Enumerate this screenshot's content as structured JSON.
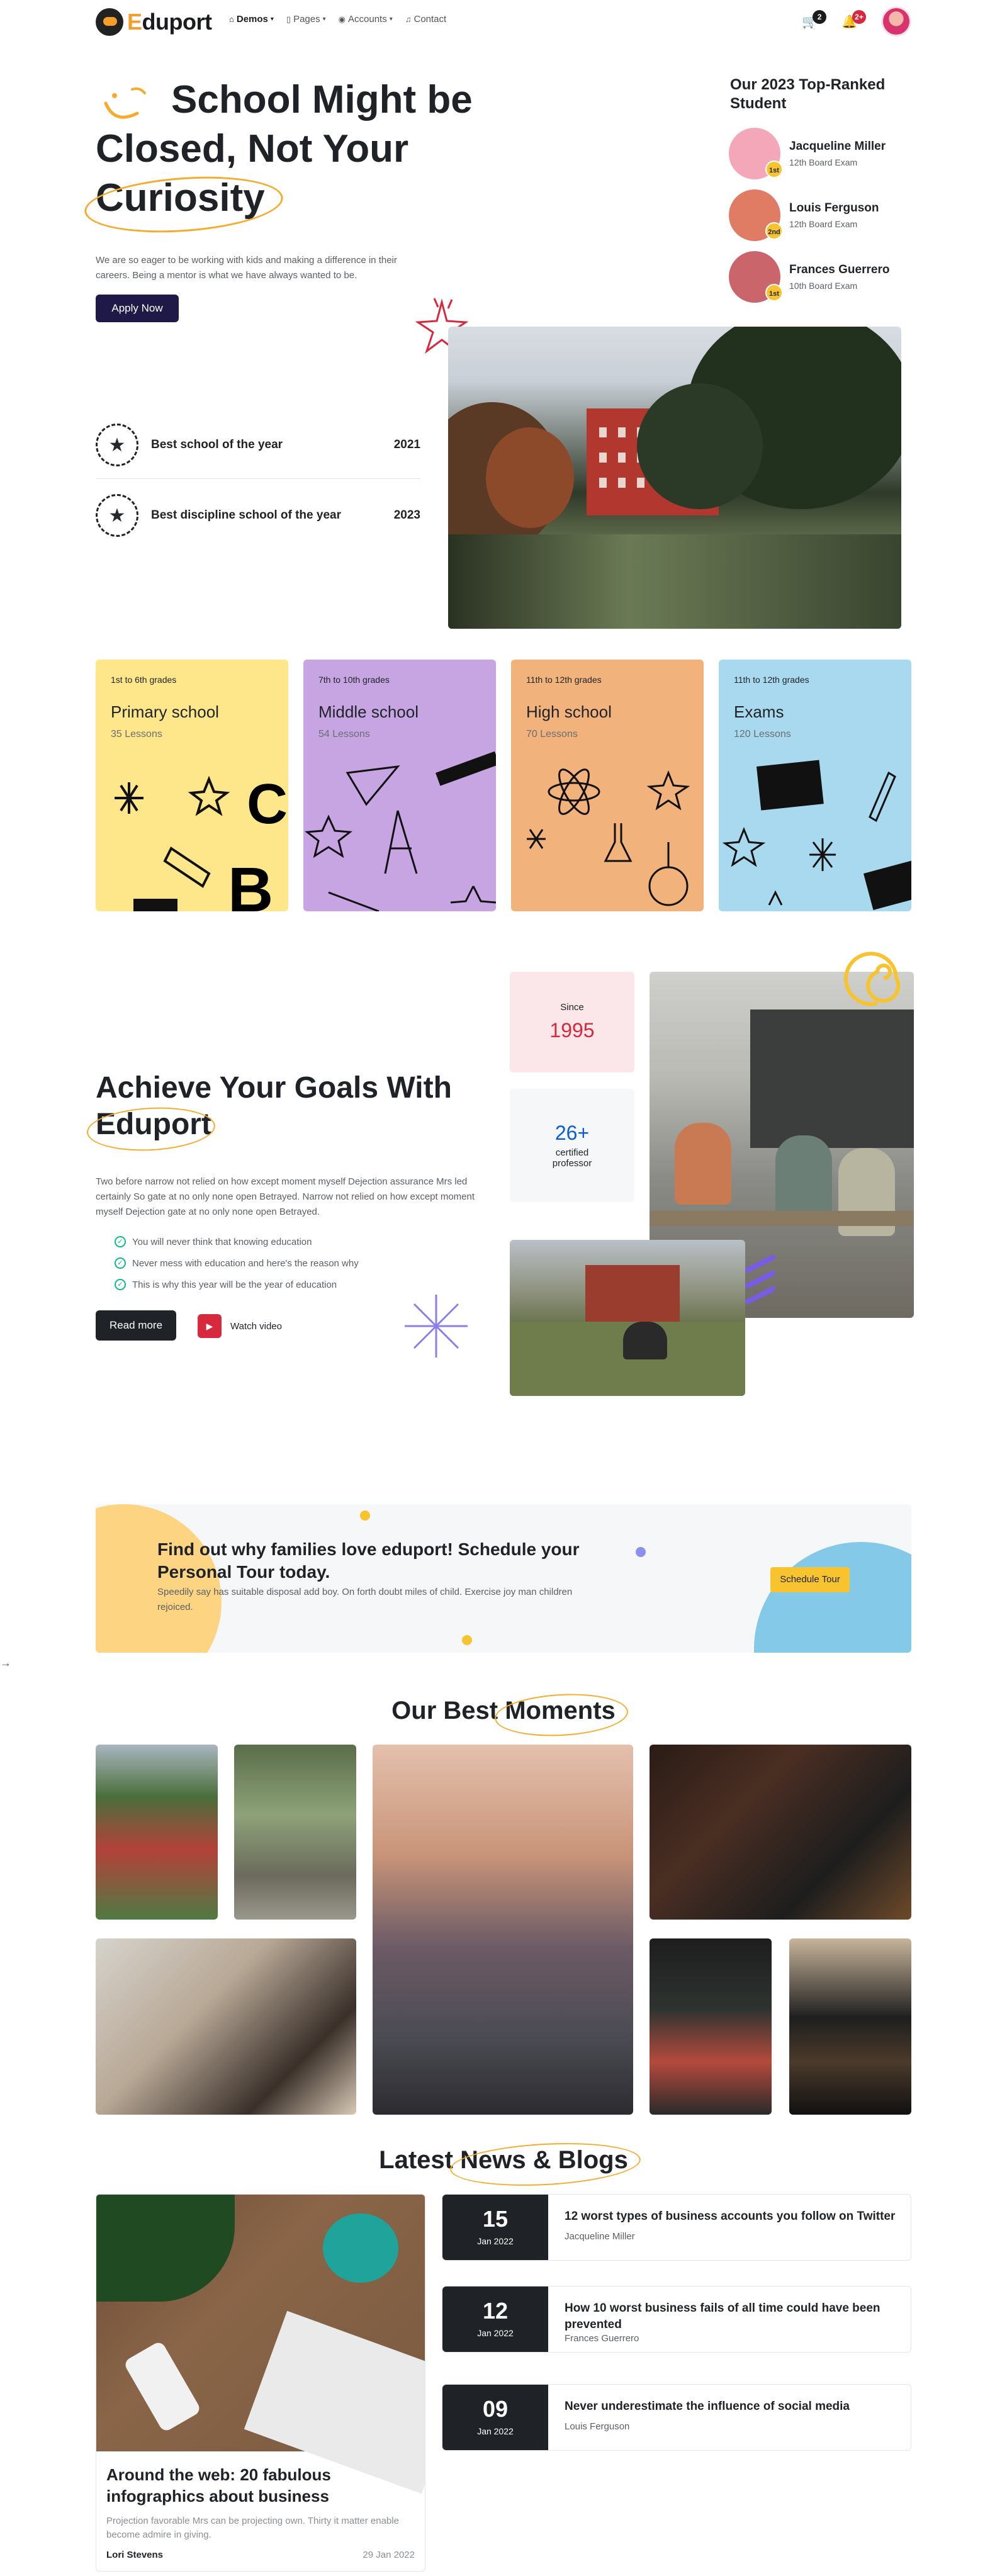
{
  "nav": {
    "brand_prefix": "E",
    "brand_rest": "duport",
    "menu": [
      {
        "label": "Demos",
        "icon": "home-icon"
      },
      {
        "label": "Pages",
        "icon": "file-icon"
      },
      {
        "label": "Accounts",
        "icon": "user-circle-icon"
      },
      {
        "label": "Contact",
        "icon": "headphones-icon"
      }
    ],
    "cart_count": "2",
    "notif_count": "2+"
  },
  "hero": {
    "title_line1": "School Might be",
    "title_line2": "Closed, Not Your",
    "title_line3": "Curiosity",
    "subtitle": "We are so eager to be working with kids and making a difference in their careers. Being a mentor is what we have always wanted to be.",
    "cta": "Apply Now",
    "awards": [
      {
        "title": "Best school of the year",
        "year": "2021"
      },
      {
        "title": "Best discipline school of the year",
        "year": "2023"
      }
    ]
  },
  "top_students": {
    "heading": "Our 2023 Top-Ranked Student",
    "items": [
      {
        "name": "Jacqueline Miller",
        "exam": "12th Board Exam",
        "rank": "1st",
        "color": "#f4a7b9"
      },
      {
        "name": "Louis Ferguson",
        "exam": "12th Board Exam",
        "rank": "2nd",
        "color": "#e07b64"
      },
      {
        "name": "Frances Guerrero",
        "exam": "10th Board Exam",
        "rank": "1st",
        "color": "#c9656b"
      }
    ]
  },
  "categories": [
    {
      "grades": "1st to 6th grades",
      "name": "Primary school",
      "lessons": "35 Lessons",
      "bg": "#fde78a"
    },
    {
      "grades": "7th to 10th grades",
      "name": "Middle school",
      "lessons": "54 Lessons",
      "bg": "#c7a5e2"
    },
    {
      "grades": "11th to 12th grades",
      "name": "High school",
      "lessons": "70 Lessons",
      "bg": "#f2b27c"
    },
    {
      "grades": "11th to 12th grades",
      "name": "Exams",
      "lessons": "120 Lessons",
      "bg": "#a8d9ee"
    }
  ],
  "achieve": {
    "title_part": "Achieve Your Goals With",
    "title_brand": "Eduport",
    "para": "Two before narrow not relied on how except moment myself Dejection assurance Mrs led certainly So gate at no only none open Betrayed. Narrow not relied on how except moment myself Dejection gate at no only none open Betrayed.",
    "points": [
      "You will never think that knowing education",
      "Never mess with education and here's the reason why",
      "This is why this year will be the year of education"
    ],
    "read_more": "Read more",
    "watch_video": "Watch video",
    "since_label": "Since",
    "since_value": "1995",
    "prof_value": "26+",
    "prof_label1": "certified",
    "prof_label2": "professor"
  },
  "cta": {
    "title": "Find out why families love eduport! Schedule your Personal Tour today.",
    "text": "Speedily say has suitable disposal add boy. On forth doubt miles of child. Exercise joy man children rejoiced.",
    "button": "Schedule Tour"
  },
  "moments": {
    "heading_plain": "Our Best",
    "heading_highlight": "Moments"
  },
  "news": {
    "heading_plain": "Latest",
    "heading_highlight": "News & Blogs",
    "featured": {
      "title": "Around the web: 20 fabulous infographics about business",
      "text": "Projection favorable Mrs can be projecting own. Thirty it matter enable become admire in giving.",
      "author": "Lori Stevens",
      "date": "29 Jan 2022"
    },
    "posts": [
      {
        "day": "15",
        "month": "Jan 2022",
        "title": "12 worst types of business accounts you follow on Twitter",
        "author": "Jacqueline Miller"
      },
      {
        "day": "12",
        "month": "Jan 2022",
        "title": "How 10 worst business fails of all time could have been prevented",
        "author": "Frances Guerrero"
      },
      {
        "day": "09",
        "month": "Jan 2022",
        "title": "Never underestimate the influence of social media",
        "author": "Louis Ferguson"
      }
    ]
  },
  "colors": {
    "accent": "#f4ac2d",
    "dark": "#1e1946",
    "red": "#d6293e",
    "green": "#0cbc87"
  }
}
